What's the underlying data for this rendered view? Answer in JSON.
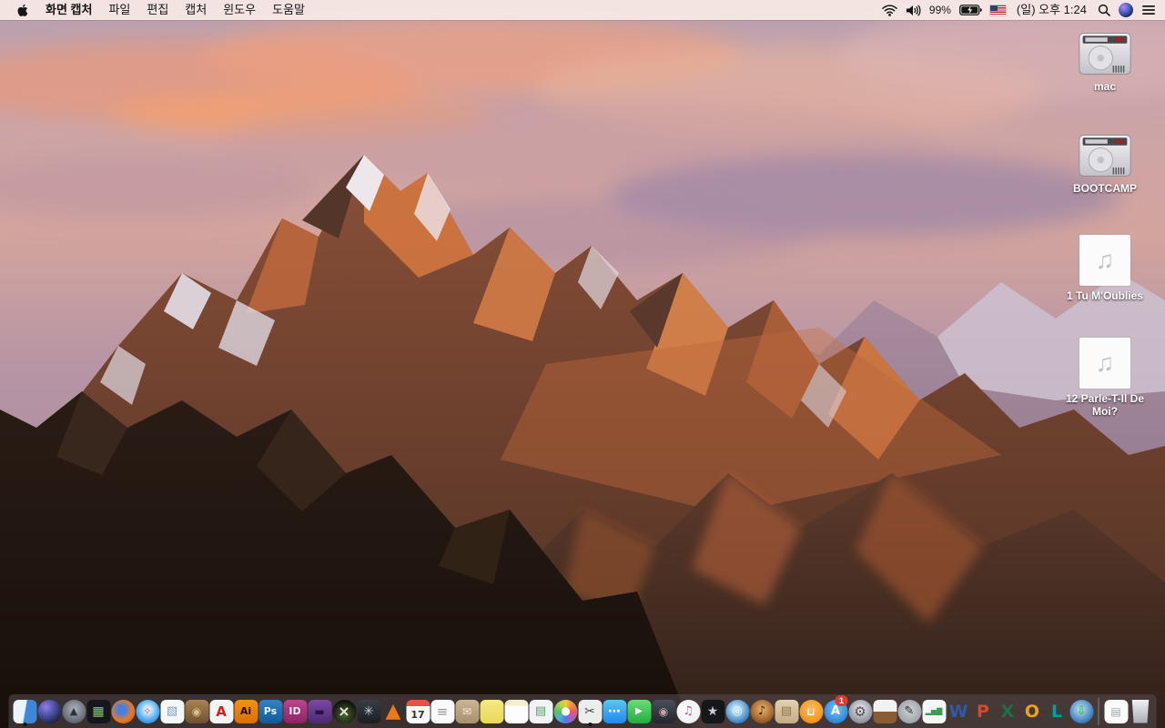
{
  "menu_bar": {
    "menus": [
      "화면 캡처",
      "파일",
      "편집",
      "캡처",
      "윈도우",
      "도움말"
    ],
    "status": {
      "battery_percent": "99%",
      "battery_charging": true,
      "clock": "(일) 오후 1:24",
      "input_source": "us-flag",
      "icons": [
        "wifi-icon",
        "volume-icon",
        "battery-charging-icon",
        "us-flag",
        "spotlight-search-icon",
        "siri-icon",
        "notification-center-icon"
      ]
    }
  },
  "desktop": {
    "icons": [
      {
        "name": "drive-mac",
        "type": "hard-drive",
        "label": "mac"
      },
      {
        "name": "drive-bootcamp",
        "type": "hard-drive",
        "label": "BOOTCAMP"
      },
      {
        "name": "audio-file-1",
        "type": "audio-file",
        "label": "1 Tu M'Oublies",
        "glyph": "♫"
      },
      {
        "name": "audio-file-2",
        "type": "audio-file",
        "label": "12 Parle-T-Il De Moi?",
        "glyph": "♫"
      }
    ]
  },
  "dock": {
    "items": [
      {
        "name": "finder",
        "shape": "sq",
        "bg": "linear-gradient(100deg,#e9f4fc 48%,#3e86d8 52%)",
        "glyph": "",
        "running": true
      },
      {
        "name": "siri",
        "shape": "ci",
        "bg": "radial-gradient(circle at 35% 30%,#8f7fe8 0%,#4a4fa0 40%,#1e2344 78%)",
        "glyph": ""
      },
      {
        "name": "launchpad",
        "shape": "ci",
        "bg": "radial-gradient(circle at 50% 40%,#aeb4bc,#585f68 78%)",
        "glyph": "▲",
        "color": "#2b3138",
        "fs": 11
      },
      {
        "name": "mission-control",
        "shape": "sq",
        "bg": "#15171c",
        "glyph": "▦",
        "color": "#8cc86a",
        "fs": 14
      },
      {
        "name": "firefox",
        "shape": "ci",
        "bg": "radial-gradient(circle at 42% 42%,#4a7fe0 22%,#e87a28 55%,#c8500f 88%)",
        "glyph": ""
      },
      {
        "name": "safari",
        "shape": "ci",
        "bg": "radial-gradient(circle at 50% 42%,#f0f8ff 8%,#54b0f5 55%,#1d72c8 92%)",
        "glyph": "✧",
        "color": "#e04040",
        "fs": 11
      },
      {
        "name": "preview",
        "shape": "sq",
        "bg": "#f6f7f8",
        "glyph": "▧",
        "color": "#7aa0c0",
        "fs": 13
      },
      {
        "name": "journal-notebook",
        "shape": "sq",
        "bg": "linear-gradient(180deg,#ab8352,#6e5130)",
        "glyph": "◉",
        "color": "#d9c08c",
        "fs": 12
      },
      {
        "name": "acrobat",
        "shape": "sq",
        "bg": "#f4f4f4",
        "glyph": "A",
        "color": "#d2201f",
        "fs": 15,
        "weight": 700
      },
      {
        "name": "illustrator",
        "shape": "sq",
        "bg": "linear-gradient(180deg,#f5920f,#d96f04)",
        "glyph": "Ai",
        "color": "#201000",
        "fs": 11,
        "weight": 700
      },
      {
        "name": "photoshop",
        "shape": "sq",
        "bg": "linear-gradient(180deg,#2f84c8,#125a96)",
        "glyph": "Ps",
        "color": "#eaf4fc",
        "fs": 11,
        "weight": 700
      },
      {
        "name": "indesign",
        "shape": "sq",
        "bg": "linear-gradient(180deg,#c0448c,#8c2460)",
        "glyph": "ID",
        "color": "#fce8f4",
        "fs": 11,
        "weight": 700
      },
      {
        "name": "toast",
        "shape": "sq",
        "bg": "linear-gradient(180deg,#7a4aa8,#4a2a70)",
        "glyph": "▬",
        "color": "#2a1442",
        "fs": 12
      },
      {
        "name": "xee",
        "shape": "ci",
        "bg": "radial-gradient(circle at 50% 62%,#4a6a2a 0%,#101010 72%)",
        "glyph": "×",
        "color": "#e8e8e8",
        "fs": 16,
        "weight": 700
      },
      {
        "name": "aperture-fan",
        "shape": "sq",
        "bg": "linear-gradient(180deg,#3a3d45,#1c1e24)",
        "glyph": "✳",
        "color": "#c8ccd4",
        "fs": 14
      },
      {
        "name": "vlc",
        "shape": "none",
        "glyph": "▲",
        "color": "#e87a1e",
        "fs": 22
      },
      {
        "name": "calendar",
        "shape": "sq",
        "cls": "cal",
        "bg": "linear-gradient(180deg,#ec5044 27%,#fafafa 27%)",
        "glyph": "17",
        "color": "#333333",
        "fs": 11,
        "weight": 700
      },
      {
        "name": "reminders",
        "shape": "sq",
        "bg": "#fafafa",
        "glyph": "≡",
        "color": "#999999",
        "fs": 15
      },
      {
        "name": "coteditor-box",
        "shape": "sq",
        "bg": "linear-gradient(180deg,#cdb594,#a8906e)",
        "glyph": "✉",
        "color": "#f0ead8",
        "fs": 12
      },
      {
        "name": "stickies",
        "shape": "sq",
        "bg": "linear-gradient(180deg,#f5ea82,#e8d85a)",
        "glyph": ""
      },
      {
        "name": "notepad",
        "shape": "sq",
        "bg": "linear-gradient(180deg,#f2edcf 25%,#fdfdfd 25%)",
        "glyph": ""
      },
      {
        "name": "slides-docs",
        "shape": "sq",
        "bg": "#f2f3f4",
        "glyph": "▤",
        "color": "#5a9e68",
        "fs": 13
      },
      {
        "name": "photos",
        "shape": "ci",
        "cls": "photos",
        "bg": "radial-gradient(circle,#ffffff 24%,rgba(255,255,255,0) 25%),conic-gradient(#f2c843,#ef8e3c,#e25c64,#b05cc2,#5a74e0,#49b4d8,#55c06a,#a2d44c,#f2c843)",
        "glyph": ""
      },
      {
        "name": "grab-screen-capture",
        "shape": "sq",
        "bg": "#eceded",
        "glyph": "✂",
        "color": "#4a4a4a",
        "fs": 14,
        "running": true
      },
      {
        "name": "messages",
        "shape": "sq",
        "bg": "linear-gradient(180deg,#58c6fa,#1e88ee)",
        "glyph": "⋯",
        "color": "#ffffff",
        "fs": 14,
        "weight": 700
      },
      {
        "name": "facetime",
        "shape": "sq",
        "bg": "linear-gradient(180deg,#67df74,#21ad3c)",
        "glyph": "▶",
        "color": "#ffffff",
        "fs": 10
      },
      {
        "name": "photo-booth",
        "shape": "sq",
        "bg": "linear-gradient(180deg,#4a4f58,#23262c)",
        "glyph": "◉",
        "color": "#c8a0a8",
        "fs": 12
      },
      {
        "name": "itunes",
        "shape": "ci",
        "bg": "radial-gradient(circle at 45% 40%,#ffffff,#eef0f2 70%,#d8dce0)",
        "glyph": "♫",
        "color": "#e8488c",
        "fs": 13
      },
      {
        "name": "imovie",
        "shape": "sq",
        "bg": "#17171a",
        "glyph": "★",
        "color": "#caced6",
        "fs": 14
      },
      {
        "name": "dvd-player",
        "shape": "ci",
        "bg": "radial-gradient(circle at 45% 40%,#bfe2f5 15%,#3a80c4 70%,#1d5a9a)",
        "glyph": "◎",
        "color": "#e8f4fc",
        "fs": 13
      },
      {
        "name": "garageband",
        "shape": "ci",
        "bg": "radial-gradient(circle at 50% 40%,#e0a860 10%,#8a4f20 78%)",
        "glyph": "♪",
        "color": "#3a2208",
        "fs": 13
      },
      {
        "name": "stacked-documents",
        "shape": "sq",
        "bg": "linear-gradient(180deg,#e2d2ae,#c2ac84)",
        "glyph": "▤",
        "color": "#8a7450",
        "fs": 13
      },
      {
        "name": "ibooks",
        "shape": "ci",
        "bg": "radial-gradient(circle at 50% 38%,#ffc05e,#f28a12 82%)",
        "glyph": "⊔",
        "color": "#ffffff",
        "fs": 12,
        "weight": 700
      },
      {
        "name": "app-store",
        "shape": "ci",
        "bg": "radial-gradient(circle at 50% 40%,#7cc0f8,#1d78d4 88%)",
        "glyph": "A",
        "color": "#ffffff",
        "fs": 13,
        "weight": 700,
        "badge": "1"
      },
      {
        "name": "system-preferences",
        "shape": "ci",
        "bg": "radial-gradient(circle at 50% 40%,#e0e2e6 10%,#9aa0a8 60%,#70767e)",
        "glyph": "⚙",
        "color": "#4a4e55",
        "fs": 15
      },
      {
        "name": "keynote",
        "shape": "sq",
        "bg": "linear-gradient(180deg,#f2f2f2 50%,#8a5c34 50%)",
        "glyph": ""
      },
      {
        "name": "pages",
        "shape": "ci",
        "bg": "radial-gradient(circle at 50% 45%,#d0d4d8,#8a9098)",
        "glyph": "✎",
        "color": "#24282e",
        "fs": 13
      },
      {
        "name": "numbers",
        "shape": "sq",
        "bg": "#f5f6f7",
        "glyph": "▂▅▇",
        "color": "#3a9e4e",
        "fs": 8
      },
      {
        "name": "ms-word",
        "shape": "none",
        "glyph": "W",
        "color": "#2b5ca8",
        "fs": 19,
        "weight": 700
      },
      {
        "name": "ms-powerpoint",
        "shape": "none",
        "glyph": "P",
        "color": "#d6492a",
        "fs": 19,
        "weight": 700
      },
      {
        "name": "ms-excel",
        "shape": "none",
        "glyph": "X",
        "color": "#1e7145",
        "fs": 19,
        "weight": 700
      },
      {
        "name": "ms-outlook",
        "shape": "none",
        "glyph": "O",
        "color": "#e8a41f",
        "fs": 19,
        "weight": 700
      },
      {
        "name": "ms-lync",
        "shape": "none",
        "glyph": "L",
        "color": "#0a9aa8",
        "fs": 19,
        "weight": 700
      },
      {
        "name": "download-manager",
        "shape": "ci",
        "bg": "radial-gradient(circle at 45% 40%,#a8d4f0 10%,#3a78b8 70%,#1d5a9a)",
        "glyph": "⇩",
        "color": "#3ec43e",
        "fs": 13,
        "weight": 700
      },
      {
        "type": "separator"
      },
      {
        "name": "recent-document",
        "shape": "sq",
        "bg": "#fbfbfb",
        "glyph": "▤",
        "color": "#9aa4ae",
        "fs": 12
      },
      {
        "name": "trash",
        "shape": "none",
        "cls": "trash",
        "glyph": ""
      }
    ]
  }
}
